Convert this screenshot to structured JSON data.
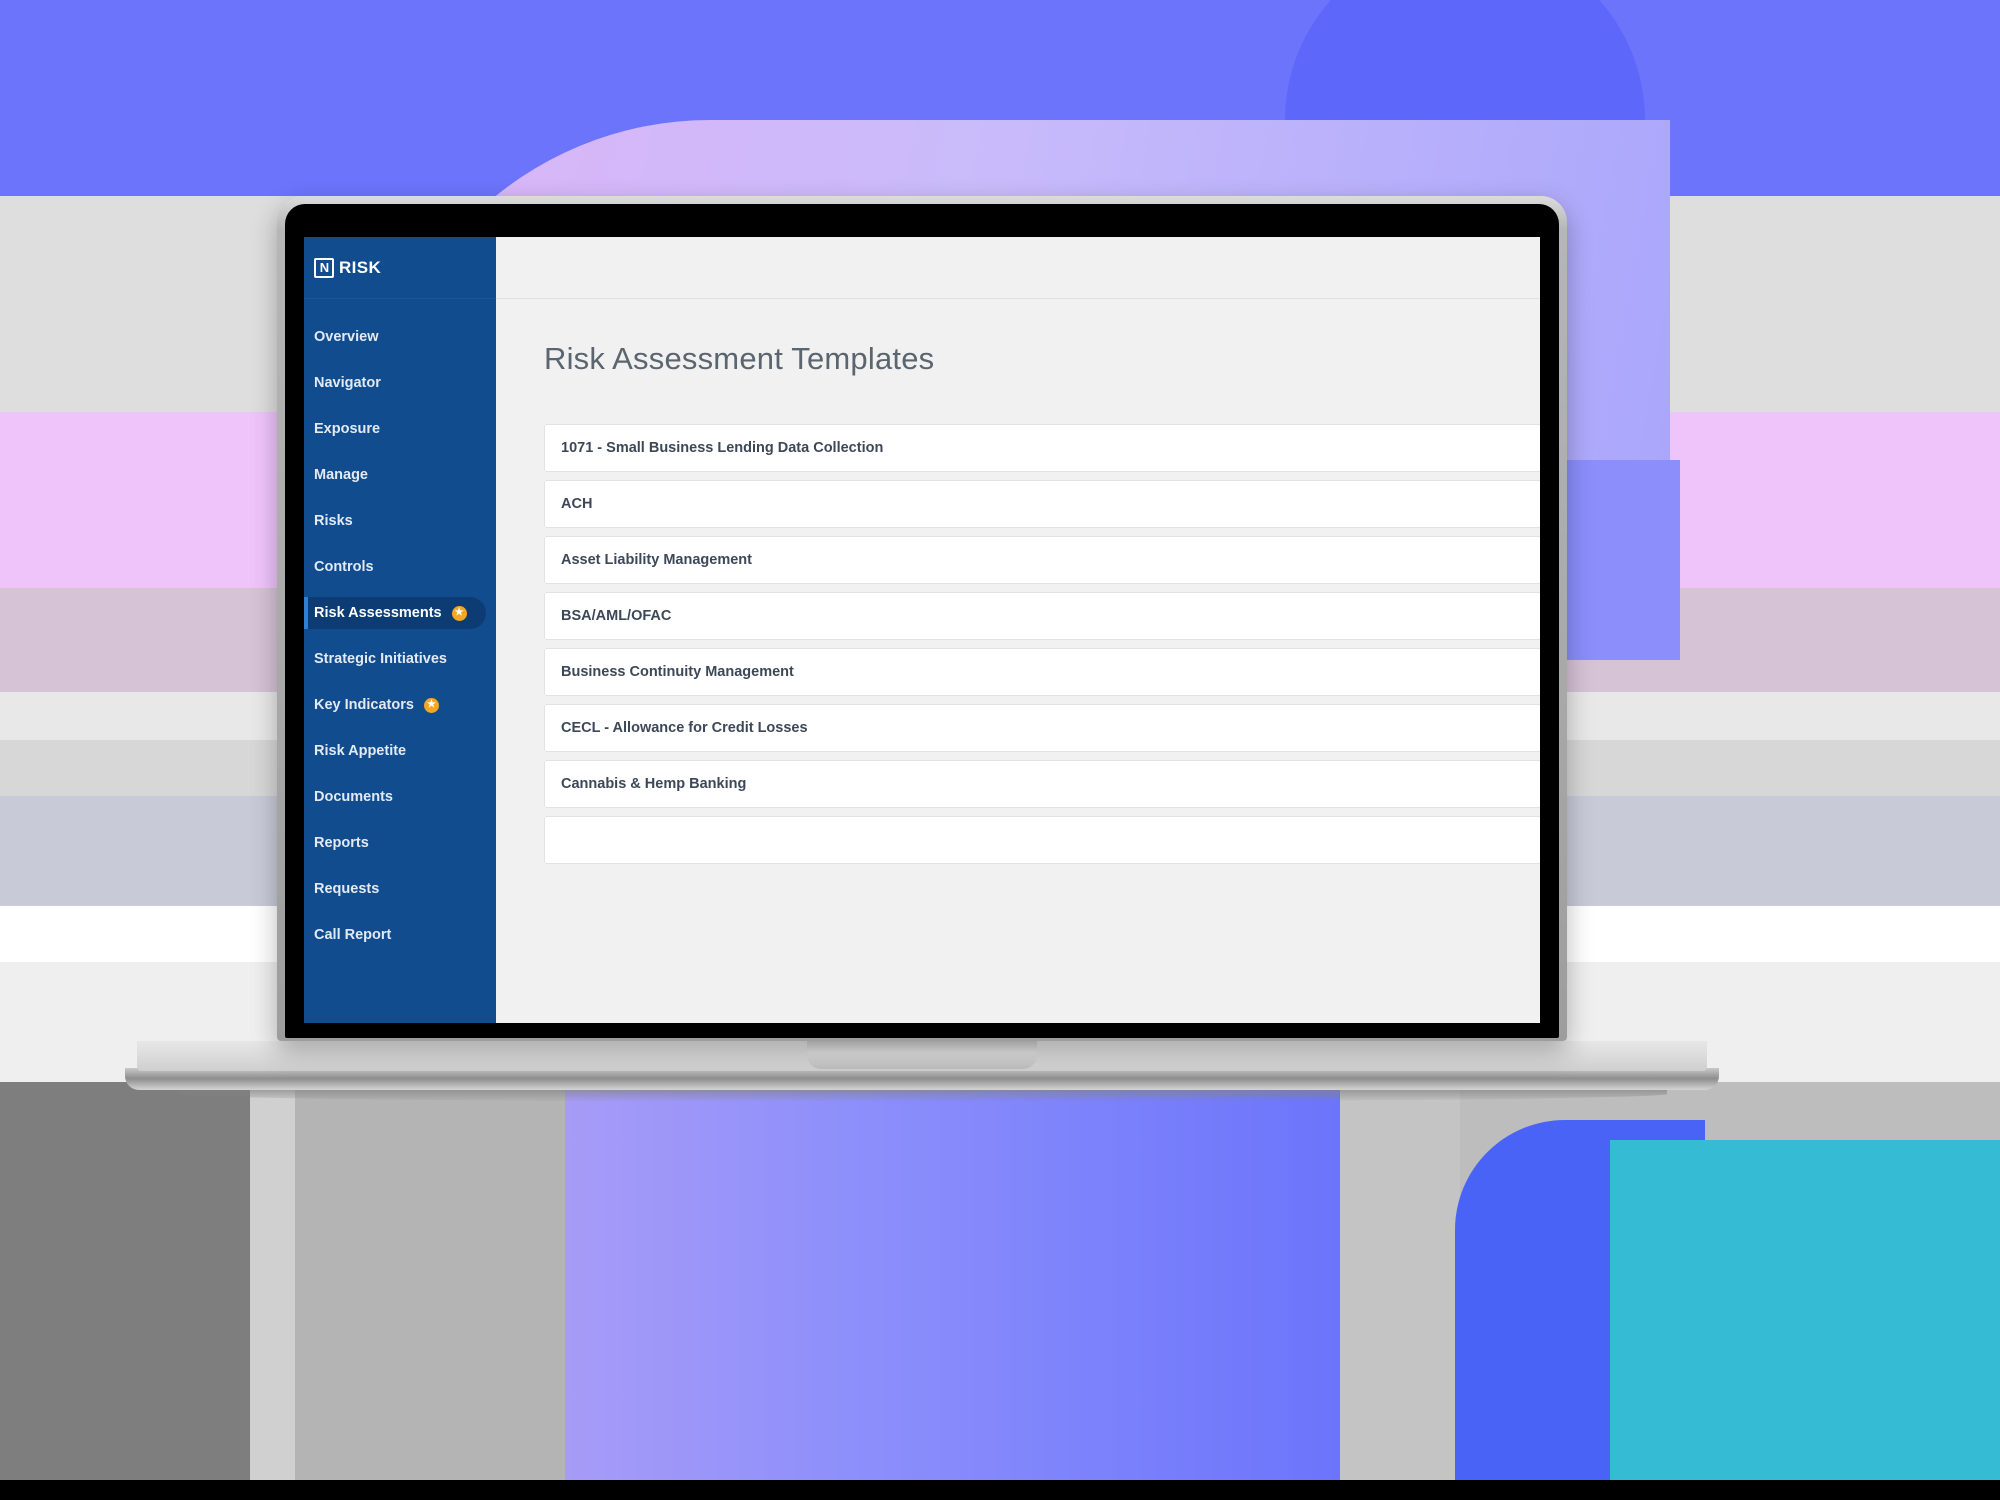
{
  "app": {
    "brand": {
      "mark": "N",
      "name": "RISK"
    },
    "sidebar": {
      "items": [
        {
          "label": "Overview",
          "active": false,
          "badge": null
        },
        {
          "label": "Navigator",
          "active": false,
          "badge": null
        },
        {
          "label": "Exposure",
          "active": false,
          "badge": null
        },
        {
          "label": "Manage",
          "active": false,
          "badge": null
        },
        {
          "label": "Risks",
          "active": false,
          "badge": null
        },
        {
          "label": "Controls",
          "active": false,
          "badge": null
        },
        {
          "label": "Risk Assessments",
          "active": true,
          "badge": "star"
        },
        {
          "label": "Strategic Initiatives",
          "active": false,
          "badge": null
        },
        {
          "label": "Key Indicators",
          "active": false,
          "badge": "star"
        },
        {
          "label": "Risk Appetite",
          "active": false,
          "badge": null
        },
        {
          "label": "Documents",
          "active": false,
          "badge": null
        },
        {
          "label": "Reports",
          "active": false,
          "badge": null
        },
        {
          "label": "Requests",
          "active": false,
          "badge": null
        },
        {
          "label": "Call Report",
          "active": false,
          "badge": null
        }
      ]
    },
    "main": {
      "page_title": "Risk Assessment Templates",
      "templates": [
        {
          "name": "1071 - Small Business Lending Data Collection"
        },
        {
          "name": "ACH"
        },
        {
          "name": "Asset Liability Management"
        },
        {
          "name": "BSA/AML/OFAC"
        },
        {
          "name": "Business Continuity Management"
        },
        {
          "name": "CECL - Allowance for Credit Losses"
        },
        {
          "name": "Cannabis & Hemp Banking"
        },
        {
          "name": ""
        }
      ]
    }
  },
  "colors": {
    "sidebar_bg": "#114c8e",
    "sidebar_active_bg": "#0c3c73",
    "accent_badge": "#f5a623",
    "page_bg": "#f1f1f1",
    "card_bg": "#ffffff",
    "title_text": "#5b6570",
    "card_text": "#3c4858",
    "bg_periwinkle": "#6b74fb",
    "bg_lavender": "#cbb6f8",
    "bg_blue": "#4a63f7",
    "bg_teal": "#35bcd4"
  }
}
